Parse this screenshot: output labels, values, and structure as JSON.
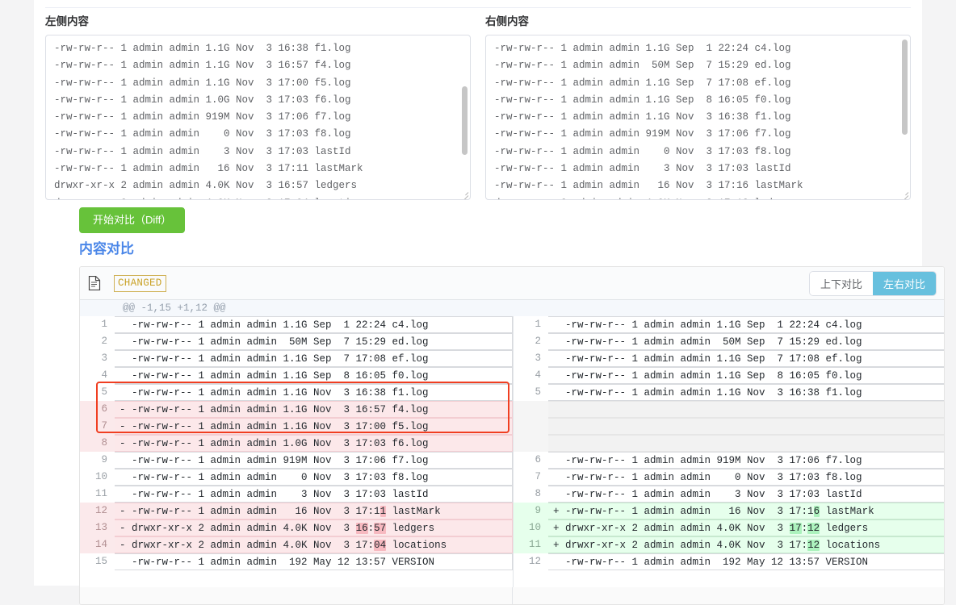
{
  "panes": {
    "left": {
      "label": "左侧内容",
      "lines": [
        "-rw-rw-r-- 1 admin admin 1.1G Nov  3 16:38 f1.log",
        "-rw-rw-r-- 1 admin admin 1.1G Nov  3 16:57 f4.log",
        "-rw-rw-r-- 1 admin admin 1.1G Nov  3 17:00 f5.log",
        "-rw-rw-r-- 1 admin admin 1.0G Nov  3 17:03 f6.log",
        "-rw-rw-r-- 1 admin admin 919M Nov  3 17:06 f7.log",
        "-rw-rw-r-- 1 admin admin    0 Nov  3 17:03 f8.log",
        "-rw-rw-r-- 1 admin admin    3 Nov  3 17:03 lastId",
        "-rw-rw-r-- 1 admin admin   16 Nov  3 17:11 lastMark",
        "drwxr-xr-x 2 admin admin 4.0K Nov  3 16:57 ledgers",
        "drwxr-xr-x 2 admin admin 4.0K Nov  3 17:04 locations",
        "-rw-rw-r-- 1 admin admin  192 May 12 13:57 VERSION"
      ]
    },
    "right": {
      "label": "右侧内容",
      "lines": [
        "-rw-rw-r-- 1 admin admin 1.1G Sep  1 22:24 c4.log",
        "-rw-rw-r-- 1 admin admin  50M Sep  7 15:29 ed.log",
        "-rw-rw-r-- 1 admin admin 1.1G Sep  7 17:08 ef.log",
        "-rw-rw-r-- 1 admin admin 1.1G Sep  8 16:05 f0.log",
        "-rw-rw-r-- 1 admin admin 1.1G Nov  3 16:38 f1.log",
        "-rw-rw-r-- 1 admin admin 919M Nov  3 17:06 f7.log",
        "-rw-rw-r-- 1 admin admin    0 Nov  3 17:03 f8.log",
        "-rw-rw-r-- 1 admin admin    3 Nov  3 17:03 lastId",
        "-rw-rw-r-- 1 admin admin   16 Nov  3 17:16 lastMark",
        "drwxr-xr-x 2 admin admin 4.0K Nov  3 17:12 ledgers",
        "drwxr-xr-x 2 admin admin 4.0K Nov  3 17:12 locations"
      ],
      "squiggle_line_index": 9
    }
  },
  "actions": {
    "diff_button": "开始对比（Diff）"
  },
  "result": {
    "title": "内容对比",
    "file_status_badge": "CHANGED",
    "view_toggle": {
      "unified_label": "上下对比",
      "split_label": "左右对比",
      "active": "split"
    },
    "hunk_header": "@@ -1,15 +1,12 @@",
    "colors": {
      "accent_green": "#67c23a",
      "accent_blue": "#67c0de",
      "title_blue": "#4a86e8",
      "badge_yellow": "#c9a227",
      "delete_bg": "#fce8ea",
      "add_bg": "#e6ffec",
      "delete_inline": "#f7b9c0",
      "add_inline": "#acf2bd",
      "focus_outline": "#f03e21"
    },
    "rows": [
      {
        "left": {
          "num": "1",
          "type": "ctx",
          "parts": [
            {
              "t": "  -rw-rw-r-- 1 admin admin 1.1G Sep  1 22:24 c4.log"
            }
          ]
        },
        "right": {
          "num": "1",
          "type": "ctx",
          "parts": [
            {
              "t": "  -rw-rw-r-- 1 admin admin 1.1G Sep  1 22:24 c4.log"
            }
          ]
        }
      },
      {
        "left": {
          "num": "2",
          "type": "ctx",
          "parts": [
            {
              "t": "  -rw-rw-r-- 1 admin admin  50M Sep  7 15:29 ed.log"
            }
          ]
        },
        "right": {
          "num": "2",
          "type": "ctx",
          "parts": [
            {
              "t": "  -rw-rw-r-- 1 admin admin  50M Sep  7 15:29 ed.log"
            }
          ]
        }
      },
      {
        "left": {
          "num": "3",
          "type": "ctx",
          "parts": [
            {
              "t": "  -rw-rw-r-- 1 admin admin 1.1G Sep  7 17:08 ef.log"
            }
          ]
        },
        "right": {
          "num": "3",
          "type": "ctx",
          "parts": [
            {
              "t": "  -rw-rw-r-- 1 admin admin 1.1G Sep  7 17:08 ef.log"
            }
          ]
        }
      },
      {
        "left": {
          "num": "4",
          "type": "ctx",
          "parts": [
            {
              "t": "  -rw-rw-r-- 1 admin admin 1.1G Sep  8 16:05 f0.log"
            }
          ]
        },
        "right": {
          "num": "4",
          "type": "ctx",
          "parts": [
            {
              "t": "  -rw-rw-r-- 1 admin admin 1.1G Sep  8 16:05 f0.log"
            }
          ]
        }
      },
      {
        "left": {
          "num": "5",
          "type": "ctx",
          "parts": [
            {
              "t": "  -rw-rw-r-- 1 admin admin 1.1G Nov  3 16:38 f1.log"
            }
          ]
        },
        "right": {
          "num": "5",
          "type": "ctx",
          "parts": [
            {
              "t": "  -rw-rw-r-- 1 admin admin 1.1G Nov  3 16:38 f1.log"
            }
          ]
        }
      },
      {
        "left": {
          "num": "6",
          "type": "del",
          "parts": [
            {
              "t": "- -rw-rw-r-- 1 admin admin 1.1G Nov  3 16:57 f4.log"
            }
          ]
        },
        "right": {
          "num": "",
          "type": "blank",
          "parts": [
            {
              "t": ""
            }
          ]
        }
      },
      {
        "left": {
          "num": "7",
          "type": "del",
          "parts": [
            {
              "t": "- -rw-rw-r-- 1 admin admin 1.1G Nov  3 17:00 f5.log"
            }
          ]
        },
        "right": {
          "num": "",
          "type": "blank",
          "parts": [
            {
              "t": ""
            }
          ]
        }
      },
      {
        "left": {
          "num": "8",
          "type": "del",
          "parts": [
            {
              "t": "- -rw-rw-r-- 1 admin admin 1.0G Nov  3 17:03 f6.log"
            }
          ]
        },
        "right": {
          "num": "",
          "type": "blank",
          "parts": [
            {
              "t": ""
            }
          ]
        }
      },
      {
        "left": {
          "num": "9",
          "type": "ctx",
          "parts": [
            {
              "t": "  -rw-rw-r-- 1 admin admin 919M Nov  3 17:06 f7.log"
            }
          ]
        },
        "right": {
          "num": "6",
          "type": "ctx",
          "parts": [
            {
              "t": "  -rw-rw-r-- 1 admin admin 919M Nov  3 17:06 f7.log"
            }
          ]
        }
      },
      {
        "left": {
          "num": "10",
          "type": "ctx",
          "parts": [
            {
              "t": "  -rw-rw-r-- 1 admin admin    0 Nov  3 17:03 f8.log"
            }
          ]
        },
        "right": {
          "num": "7",
          "type": "ctx",
          "parts": [
            {
              "t": "  -rw-rw-r-- 1 admin admin    0 Nov  3 17:03 f8.log"
            }
          ]
        }
      },
      {
        "left": {
          "num": "11",
          "type": "ctx",
          "parts": [
            {
              "t": "  -rw-rw-r-- 1 admin admin    3 Nov  3 17:03 lastId"
            }
          ]
        },
        "right": {
          "num": "8",
          "type": "ctx",
          "parts": [
            {
              "t": "  -rw-rw-r-- 1 admin admin    3 Nov  3 17:03 lastId"
            }
          ]
        }
      },
      {
        "left": {
          "num": "12",
          "type": "del",
          "parts": [
            {
              "t": "- -rw-rw-r-- 1 admin admin   16 Nov  3 17:1"
            },
            {
              "t": "1",
              "hl": true
            },
            {
              "t": " lastMark"
            }
          ]
        },
        "right": {
          "num": "9",
          "type": "add",
          "parts": [
            {
              "t": "+ -rw-rw-r-- 1 admin admin   16 Nov  3 17:1"
            },
            {
              "t": "6",
              "hl": true
            },
            {
              "t": " lastMark"
            }
          ]
        }
      },
      {
        "left": {
          "num": "13",
          "type": "del",
          "parts": [
            {
              "t": "- drwxr-xr-x 2 admin admin 4.0K Nov  3 "
            },
            {
              "t": "16",
              "hl": true
            },
            {
              "t": ":"
            },
            {
              "t": "57",
              "hl": true
            },
            {
              "t": " ledgers"
            }
          ]
        },
        "right": {
          "num": "10",
          "type": "add",
          "parts": [
            {
              "t": "+ drwxr-xr-x 2 admin admin 4.0K Nov  3 "
            },
            {
              "t": "17",
              "hl": true
            },
            {
              "t": ":"
            },
            {
              "t": "12",
              "hl": true
            },
            {
              "t": " ledgers"
            }
          ]
        }
      },
      {
        "left": {
          "num": "14",
          "type": "del",
          "parts": [
            {
              "t": "- drwxr-xr-x 2 admin admin 4.0K Nov  3 17:"
            },
            {
              "t": "04",
              "hl": true
            },
            {
              "t": " locations"
            }
          ]
        },
        "right": {
          "num": "11",
          "type": "add",
          "parts": [
            {
              "t": "+ drwxr-xr-x 2 admin admin 4.0K Nov  3 17:"
            },
            {
              "t": "12",
              "hl": true
            },
            {
              "t": " locations"
            }
          ]
        }
      },
      {
        "left": {
          "num": "15",
          "type": "ctx",
          "parts": [
            {
              "t": "  -rw-rw-r-- 1 admin admin  192 May 12 13:57 VERSION"
            }
          ]
        },
        "right": {
          "num": "12",
          "type": "ctx",
          "parts": [
            {
              "t": "  -rw-rw-r-- 1 admin admin  192 May 12 13:57 VERSION"
            }
          ]
        }
      },
      {
        "left": {
          "num": "",
          "type": "empty-tail",
          "parts": [
            {
              "t": ""
            }
          ]
        },
        "right": {
          "num": "",
          "type": "empty-tail",
          "parts": [
            {
              "t": ""
            }
          ]
        }
      }
    ]
  }
}
